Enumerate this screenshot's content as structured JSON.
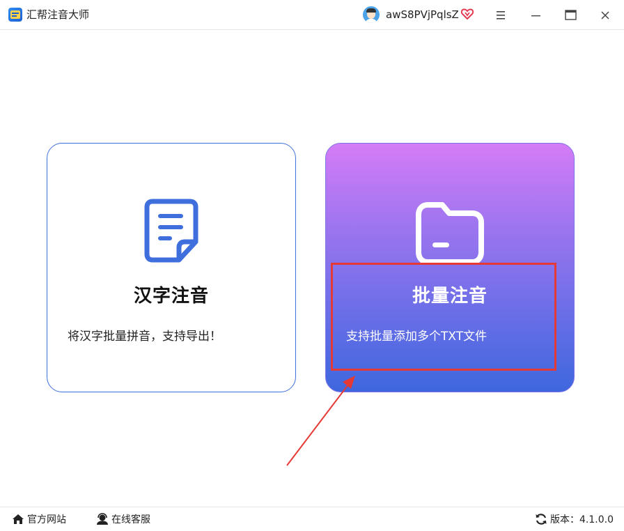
{
  "app": {
    "title": "汇帮注音大师",
    "logo_icon": "app-logo-icon"
  },
  "user": {
    "name": "awS8PVjPqlsZ",
    "vip_icon": "vip-heart-icon",
    "avatar_icon": "avatar-icon"
  },
  "window_controls": {
    "menu_icon": "hamburger-icon",
    "minimize_icon": "minimize-icon",
    "maximize_icon": "maximize-icon",
    "close_icon": "close-icon"
  },
  "cards": [
    {
      "title": "汉字注音",
      "description": "将汉字批量拼音，支持导出！",
      "icon": "document-icon",
      "accent": "#3f6fdc"
    },
    {
      "title": "批量注音",
      "description": "支持批量添加多个TXT文件",
      "icon": "folder-icon",
      "gradient": [
        "#d47cf6",
        "#3e67de"
      ]
    }
  ],
  "annotation": {
    "highlight_color": "#e53935"
  },
  "footer": {
    "official_site": "官方网站",
    "online_service": "在线客服",
    "version": "版本：4.1.0.0"
  }
}
